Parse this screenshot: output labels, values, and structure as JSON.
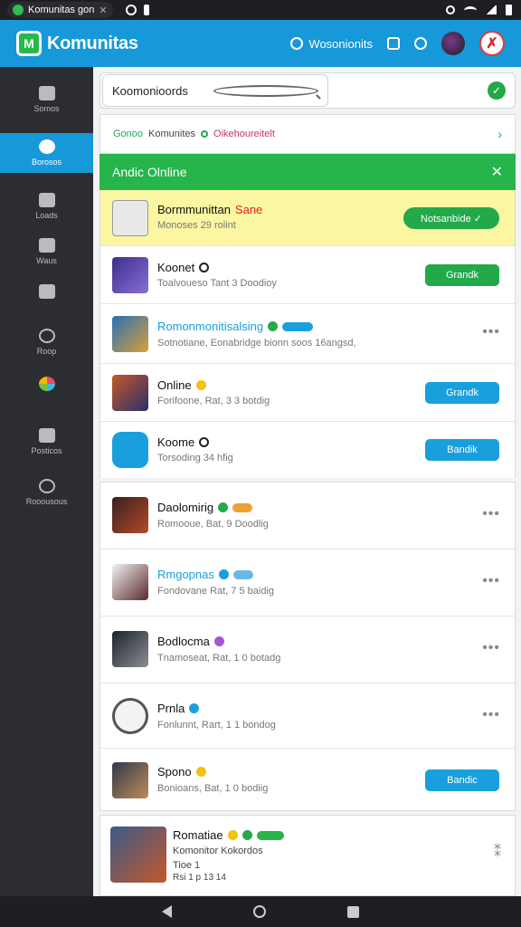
{
  "statusbar": {
    "tab_label": "Komunitas gon",
    "tab_close": "✕"
  },
  "appbar": {
    "logo_letter": "M",
    "title": "Komunitas",
    "link_label": "Wosonionits",
    "avatar2_letter": "✗"
  },
  "sidebar": {
    "items": [
      {
        "label": "Somos"
      },
      {
        "label": "Borosos"
      },
      {
        "label": "Loads"
      },
      {
        "label": "Waus"
      },
      {
        "label": ""
      },
      {
        "label": "Roop"
      },
      {
        "label": ""
      },
      {
        "label": "Posticos"
      },
      {
        "label": "Rooousous"
      }
    ]
  },
  "search": {
    "value": "Koomonioords",
    "ok": "✓"
  },
  "crumbs": {
    "c1": "Gonoo",
    "c2": "Komunites",
    "c3": "Oikehoureitelt",
    "chev": "›"
  },
  "banner": {
    "label": "Andic Olnline",
    "close": "✕"
  },
  "rows": [
    {
      "name": "Bormmunittan",
      "name_accent": "Sane",
      "sub": "Monoses 29 rolint",
      "button": "Notsanbide ✓"
    },
    {
      "name": "Koonet",
      "sub": "Toalvoueso Tant 3 Doodioy",
      "button": "Grandk"
    },
    {
      "name": "Romonmonitisalsing",
      "sub": "Sotnotiane, Eonabridge bionn soos 16angsd,",
      "more": "•••"
    },
    {
      "name": "Online",
      "sub": "Forifoone, Rat, 3 3 botdig",
      "button": "Grandk"
    },
    {
      "name": "Koome",
      "sub": "Torsoding 34 hfig",
      "button": "Bandik"
    },
    {
      "name": "Daolomirig",
      "sub": "Romooue, Bat, 9 Doodlig",
      "more": "•••"
    },
    {
      "name": "Rmgopnas",
      "sub": "Fondovane Rat, 7 5 baidig",
      "more": "•••"
    },
    {
      "name": "Bodlocma",
      "sub": "Tnamoseat, Rat, 1 0 botadg",
      "more": "•••"
    },
    {
      "name": "Prnla",
      "sub": "Fonlunnt, Rart, 1 1 bondog",
      "more": "•••"
    },
    {
      "name": "Spono",
      "sub": "Bonioans, Bat, 1 0 bodiig",
      "button": "Bandic"
    },
    {
      "name": "Romatiae",
      "sub": "Komonitor Kokordos",
      "sub2": "Tioe 1",
      "sub3": "Rsi 1 p 13 14",
      "more": "⁑"
    }
  ]
}
